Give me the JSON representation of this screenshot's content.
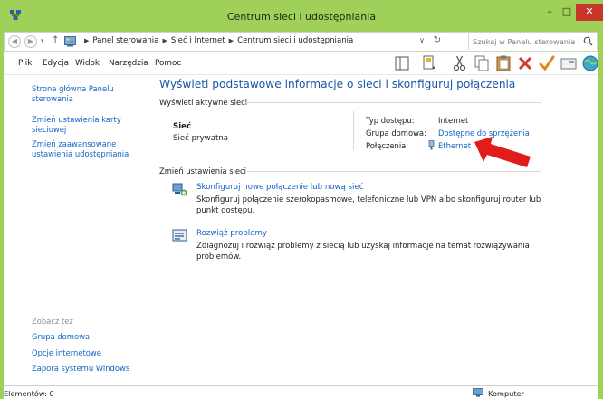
{
  "window": {
    "title": "Centrum sieci i udostępniania",
    "minimize_glyph": "–",
    "maximize_glyph": "□",
    "close_glyph": "✕",
    "accent_color": "#9ed05a"
  },
  "address": {
    "breadcrumbs": [
      "Panel sterowania",
      "Sieć i Internet",
      "Centrum sieci i udostępniania"
    ],
    "search_placeholder": "Szukaj w Panelu sterowania"
  },
  "menu": [
    "Plik",
    "Edycja",
    "Widok",
    "Narzędzia",
    "Pomoc"
  ],
  "toolbar_icons": [
    "view-pane-icon",
    "properties-icon",
    "cut-icon",
    "copy-icon",
    "paste-icon",
    "delete-icon",
    "apply-icon",
    "folder-icon",
    "globe-icon"
  ],
  "sidebar": {
    "links": [
      "Strona główna Panelu sterowania",
      "Zmień ustawienia karty sieciowej",
      "Zmień zaawansowane ustawienia udostępniania"
    ],
    "see_also_heading": "Zobacz też",
    "see_also": [
      "Grupa domowa",
      "Opcje internetowe",
      "Zapora systemu Windows"
    ]
  },
  "main": {
    "title": "Wyświetl podstawowe informacje o sieci i skonfiguruj połączenia",
    "active_networks_heading": "Wyświetl aktywne sieci",
    "network_name": "Sieć",
    "network_type": "Sieć prywatna",
    "access_type_label": "Typ dostępu:",
    "access_type_value": "Internet",
    "homegroup_label": "Grupa domowa:",
    "homegroup_value": "Dostępne do sprzężenia",
    "connections_label": "Połączenia:",
    "connections_value": "Ethernet",
    "change_settings_heading": "Zmień ustawienia sieci",
    "tasks": [
      {
        "link": "Skonfiguruj nowe połączenie lub nową sieć",
        "description": "Skonfiguruj połączenie szerokopasmowe, telefoniczne lub VPN albo skonfiguruj router lub punkt dostępu."
      },
      {
        "link": "Rozwiąż problemy",
        "description": "Zdiagnozuj i rozwiąż problemy z siecią lub uzyskaj informacje na temat rozwiązywania problemów."
      }
    ]
  },
  "statusbar": {
    "items": "Elementów: 0",
    "location": "Komputer"
  },
  "colors": {
    "link": "#1464c6",
    "title": "#1a58a8",
    "annotation_arrow": "#e21b1b"
  }
}
